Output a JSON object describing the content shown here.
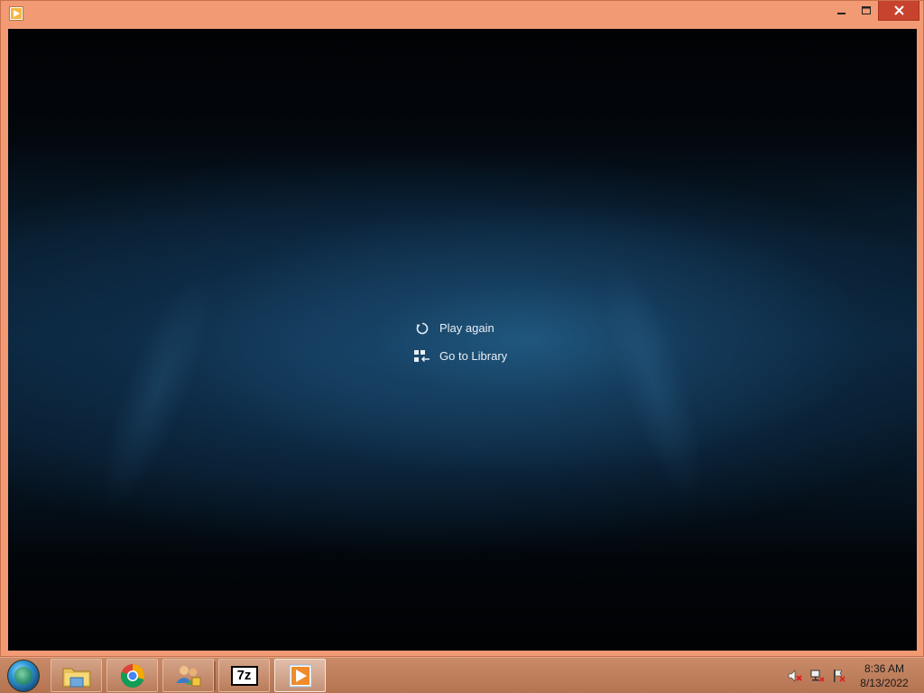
{
  "window": {
    "title_icon": "media-player-icon",
    "controls": {
      "minimize": "—",
      "maximize": "☐",
      "close": "✕"
    }
  },
  "player": {
    "menu": [
      {
        "label": "Play again",
        "icon": "replay-icon"
      },
      {
        "label": "Go to Library",
        "icon": "library-icon"
      }
    ]
  },
  "taskbar": {
    "pinned": [
      {
        "name": "file-explorer",
        "icon": "folder-icon"
      },
      {
        "name": "chrome",
        "icon": "chrome-icon"
      },
      {
        "name": "users-app",
        "icon": "users-icon"
      },
      {
        "name": "7zip",
        "icon": "7zip-icon",
        "text": "7z"
      },
      {
        "name": "media-player",
        "icon": "media-player-icon",
        "active": true
      }
    ],
    "tray": [
      "volume-muted-icon",
      "network-icon",
      "action-center-icon"
    ],
    "clock": {
      "time": "8:36 AM",
      "date": "8/13/2022"
    }
  },
  "colors": {
    "frame": "#f19a73",
    "close": "#c7432e",
    "taskbar": "#c0805d",
    "background": "#0d2b45"
  }
}
